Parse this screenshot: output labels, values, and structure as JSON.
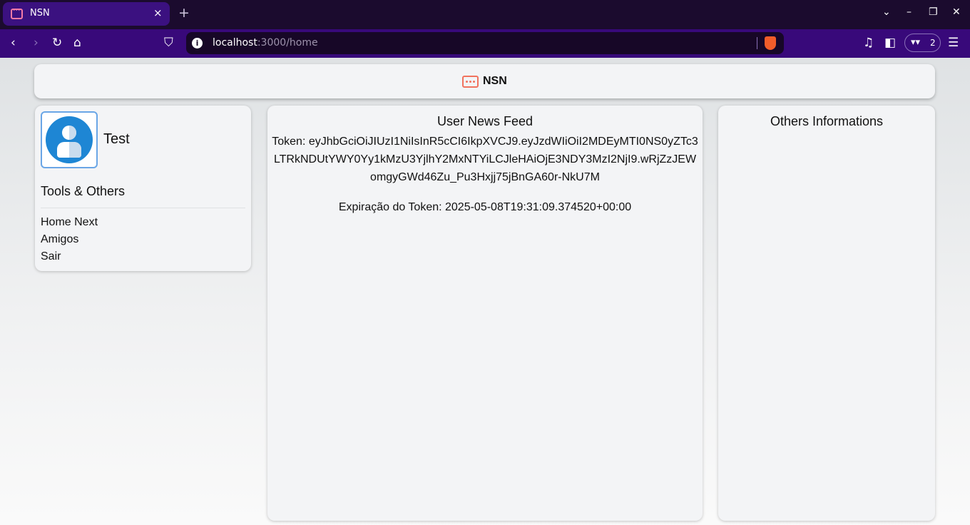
{
  "browser": {
    "tab_title": "NSN",
    "tab_close": "×",
    "new_tab": "+",
    "url_host": "localhost",
    "url_rest": ":3000/home",
    "extension_count": "2",
    "icons": [
      "back-icon",
      "forward-icon",
      "reload-icon",
      "home-icon",
      "bookmark-icon",
      "info-icon",
      "brave-shield-icon",
      "media-icon",
      "sidebar-icon",
      "extension-icon",
      "menu-icon"
    ]
  },
  "header": {
    "brand": "NSN"
  },
  "sidebar": {
    "user_name": "Test",
    "section_title": "Tools & Others",
    "items": [
      {
        "label": "Home Next"
      },
      {
        "label": "Amigos"
      },
      {
        "label": "Sair"
      }
    ]
  },
  "feed": {
    "title": "User News Feed",
    "token_label": "Token: eyJhbGciOiJIUzI1NiIsInR5cCI6IkpXVCJ9.eyJzdWIiOiI2MDEyMTI0NS0yZTc3LTRkNDUtYWY0Yy1kMzU3YjlhY2MxNTYiLCJleHAiOjE3NDY3MzI2NjI9.wRjZzJEWomgyGWd46Zu_Pu3Hxjj75jBnGA60r-NkU7M",
    "expiry_label": "Expiração do Token: 2025-05-08T19:31:09.374520+00:00"
  },
  "others": {
    "title": "Others Informations"
  },
  "colors": {
    "tabbar": "#1b0b2e",
    "navbar": "#38097a",
    "card": "#f3f4f6",
    "logo": "#f1735e",
    "avatar": "#1e86d4"
  }
}
